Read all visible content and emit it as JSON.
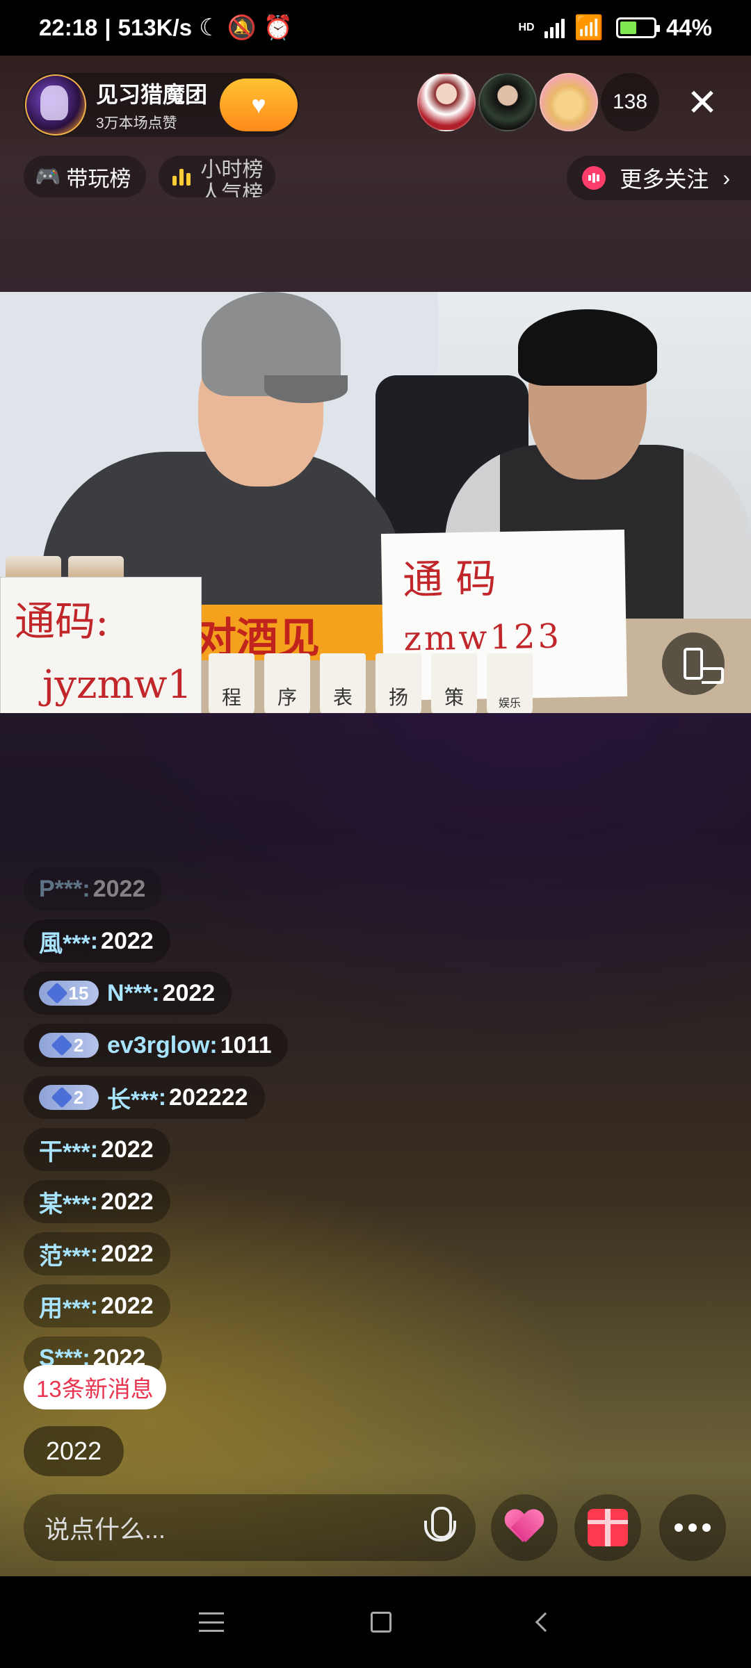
{
  "status_bar": {
    "time": "22:18",
    "separator": "|",
    "speed": "513K/s",
    "network": "HD",
    "battery": "44%"
  },
  "host": {
    "name": "见习猎魔团",
    "likes": "3万本场点赞"
  },
  "viewers": {
    "count": "138"
  },
  "rank_chips": {
    "play_rank": "带玩榜",
    "hour_rank_line1": "小时榜",
    "hour_rank_line2": "人气榜"
  },
  "more_follow": {
    "label": "更多关注"
  },
  "video": {
    "sign_left_line1": "通码:",
    "sign_left_line2": "jyzmw1",
    "sign_right_line1": "通 码",
    "sign_right_line2": "zmw123",
    "banner": "对酒见",
    "cups": [
      "程",
      "序",
      "表",
      "扬",
      "策",
      "娱乐"
    ]
  },
  "chat": {
    "messages": [
      {
        "user": "P***",
        "text": "2022"
      },
      {
        "user": "風***",
        "text": "2022"
      },
      {
        "badge": "15",
        "user": "N***",
        "text": "2022"
      },
      {
        "badge": "2",
        "user": "ev3rglow",
        "text": "1011"
      },
      {
        "badge": "2",
        "user": "长***",
        "text": "202222"
      },
      {
        "user": "干***",
        "text": "2022"
      },
      {
        "user": "某***",
        "text": "2022"
      },
      {
        "user": "范***",
        "text": "2022"
      },
      {
        "user": "用***",
        "text": "2022"
      },
      {
        "user": "S***",
        "text": "2022"
      }
    ],
    "separator": ":",
    "new_messages": "13条新消息",
    "bullet_message": "2022"
  },
  "input": {
    "placeholder": "说点什么..."
  },
  "colors": {
    "username": "#a8e4ff",
    "new_message_text": "#e8344f",
    "follow_button": "#ff9a22"
  }
}
